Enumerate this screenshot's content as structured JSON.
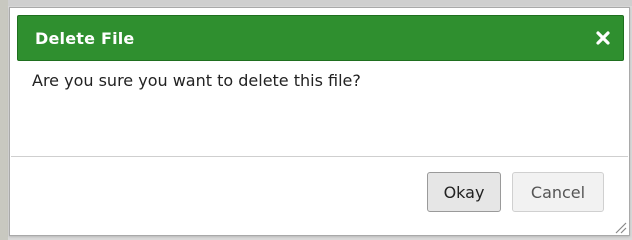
{
  "dialog": {
    "title": "Delete File",
    "message": "Are you sure you want to delete this file?",
    "close_icon": "close-icon",
    "buttons": {
      "okay_label": "Okay",
      "cancel_label": "Cancel"
    }
  },
  "colors": {
    "titlebar": "#2f8f2f",
    "title_text": "#ffffff"
  }
}
